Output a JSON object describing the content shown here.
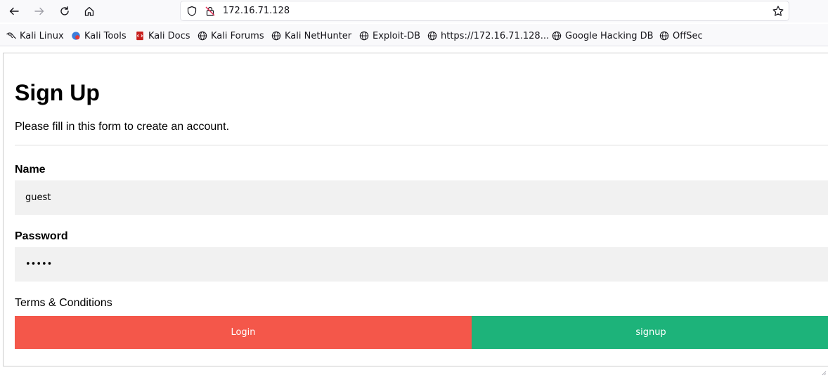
{
  "browser": {
    "url": "172.16.71.128",
    "bookmarks": [
      {
        "label": "Kali Linux",
        "icon": "kali-dragon-icon"
      },
      {
        "label": "Kali Tools",
        "icon": "kali-tools-icon"
      },
      {
        "label": "Kali Docs",
        "icon": "kali-docs-icon"
      },
      {
        "label": "Kali Forums",
        "icon": "globe-icon"
      },
      {
        "label": "Kali NetHunter",
        "icon": "globe-icon"
      },
      {
        "label": "Exploit-DB",
        "icon": "globe-icon"
      },
      {
        "label": "https://172.16.71.128...",
        "icon": "globe-icon"
      },
      {
        "label": "Google Hacking DB",
        "icon": "globe-icon"
      },
      {
        "label": "OffSec",
        "icon": "globe-icon"
      }
    ]
  },
  "page": {
    "title": "Sign Up",
    "subtitle": "Please fill in this form to create an account.",
    "name_label": "Name",
    "name_value": "guest",
    "password_label": "Password",
    "password_value": "guest",
    "terms_text": "Terms & Conditions",
    "login_label": "Login",
    "signup_label": "signup"
  },
  "colors": {
    "login_button": "#f4574a",
    "signup_button": "#1db37a",
    "input_background": "#f1f1f1"
  }
}
